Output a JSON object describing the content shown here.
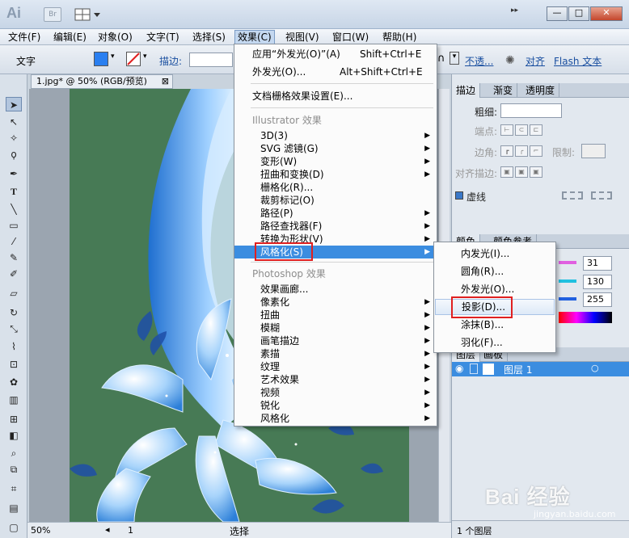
{
  "titlebar": {
    "logo": "Ai",
    "bridge": "Br",
    "window_buttons": [
      "—",
      "□",
      "✕"
    ]
  },
  "menubar": {
    "items": [
      {
        "label": "文件(F)"
      },
      {
        "label": "编辑(E)"
      },
      {
        "label": "对象(O)"
      },
      {
        "label": "文字(T)"
      },
      {
        "label": "选择(S)"
      },
      {
        "label": "效果(C)",
        "active": true
      },
      {
        "label": "视图(V)"
      },
      {
        "label": "窗口(W)"
      },
      {
        "label": "帮助(H)"
      }
    ]
  },
  "controlbar": {
    "mode_label": "文字",
    "stroke_label": "描边:",
    "opacity_label": "不透...",
    "align_label": "对齐",
    "flash_label": "Flash 文本"
  },
  "document": {
    "tab_title": "1.jpg* @ 50% (RGB/预览)",
    "close_glyph": "⊠"
  },
  "statusbar": {
    "zoom": "50%",
    "page": "1",
    "tool": "选择"
  },
  "effect_menu": {
    "top_items": [
      {
        "label": "应用“外发光(O)”(A)",
        "shortcut": "Shift+Ctrl+E"
      },
      {
        "label": "外发光(O)...",
        "shortcut": "Alt+Shift+Ctrl+E"
      }
    ],
    "raster_settings": "文档栅格效果设置(E)...",
    "illustrator_header": "Illustrator 效果",
    "illustrator_items": [
      {
        "label": "3D(3)",
        "submenu": true
      },
      {
        "label": "SVG 滤镜(G)",
        "submenu": true
      },
      {
        "label": "变形(W)",
        "submenu": true
      },
      {
        "label": "扭曲和变换(D)",
        "submenu": true
      },
      {
        "label": "栅格化(R)...",
        "submenu": false
      },
      {
        "label": "裁剪标记(O)",
        "submenu": false
      },
      {
        "label": "路径(P)",
        "submenu": true
      },
      {
        "label": "路径查找器(F)",
        "submenu": true
      },
      {
        "label": "转换为形状(V)",
        "submenu": true
      },
      {
        "label": "风格化(S)",
        "submenu": true,
        "highlighted": true
      }
    ],
    "photoshop_header": "Photoshop 效果",
    "photoshop_items": [
      {
        "label": "效果画廊...",
        "submenu": false
      },
      {
        "label": "像素化",
        "submenu": true
      },
      {
        "label": "扭曲",
        "submenu": true
      },
      {
        "label": "模糊",
        "submenu": true
      },
      {
        "label": "画笔描边",
        "submenu": true
      },
      {
        "label": "素描",
        "submenu": true
      },
      {
        "label": "纹理",
        "submenu": true
      },
      {
        "label": "艺术效果",
        "submenu": true
      },
      {
        "label": "视频",
        "submenu": true
      },
      {
        "label": "锐化",
        "submenu": true
      },
      {
        "label": "风格化",
        "submenu": true
      }
    ]
  },
  "stylize_submenu": {
    "items": [
      {
        "label": "内发光(I)..."
      },
      {
        "label": "圆角(R)..."
      },
      {
        "label": "外发光(O)..."
      },
      {
        "label": "投影(D)...",
        "hover": true
      },
      {
        "label": "涂抹(B)..."
      },
      {
        "label": "羽化(F)..."
      }
    ]
  },
  "stroke_panel": {
    "tabs": [
      "描边",
      "渐变",
      "透明度"
    ],
    "weight_label": "粗细:",
    "cap_label": "端点:",
    "corner_label": "边角:",
    "limit_label": "限制:",
    "align_label": "对齐描边:",
    "dashed_label": "虚线"
  },
  "color_panel": {
    "tabs": [
      "颜色",
      "颜色参考"
    ],
    "values": [
      "31",
      "130",
      "255"
    ]
  },
  "layers_panel": {
    "tabs": [
      "图层",
      "画板"
    ],
    "layer_name": "图层 1",
    "footer": "1 个图层"
  },
  "watermark": {
    "text": "Bai 经验",
    "sub": "jingyan.baidu.com"
  },
  "colors": {
    "artwork_bg": "#477a55",
    "menu_highlight": "#3b8de0",
    "annotation_red": "#e02020"
  }
}
